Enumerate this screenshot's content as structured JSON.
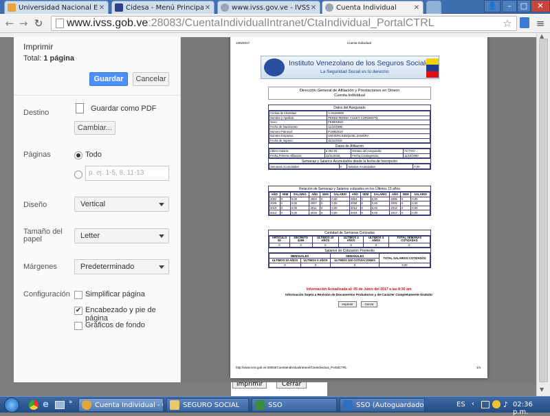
{
  "tabs": [
    {
      "title": "Universidad Nacional Experi",
      "color": "#e8a23a"
    },
    {
      "title": "Cidesa - Menú Principal",
      "color": "#2b3f8c"
    },
    {
      "title": "www.ivss.gov.ve - IVSS Inst",
      "color": "#9aa4b2"
    },
    {
      "title": "Cuenta Individual",
      "color": "#9aa4b2"
    }
  ],
  "window": {
    "minimize": "–",
    "maximize": "□",
    "close": "✕",
    "user": "👤"
  },
  "address": {
    "host": "www.ivss.gob.ve",
    "path": ":28083/CuentaIndividualIntranet/CtaIndividual_PortalCTRL"
  },
  "print": {
    "title": "Imprimir",
    "total_label": "Total:",
    "total_value": "1 página",
    "save_button": "Guardar",
    "cancel_button": "Cancelar",
    "destino_label": "Destino",
    "destino_value": "Guardar como PDF",
    "change_button": "Cambiar...",
    "paginas_label": "Páginas",
    "todo_label": "Todo",
    "range_placeholder": "p. ej. 1-5, 8, 11-13",
    "diseno_label": "Diseño",
    "diseno_value": "Vertical",
    "tamano_label_1": "Tamaño del",
    "tamano_label_2": "papel",
    "tamano_value": "Letter",
    "margenes_label": "Márgenes",
    "margenes_value": "Predeterminado",
    "config_label": "Configuración",
    "opt_simplify": "Simplificar página",
    "opt_header": "Encabezado y pie de página",
    "opt_background": "Gráficos de fondo"
  },
  "doc": {
    "date": "13/6/2017",
    "header_title": "Cuenta Individual",
    "org_name": "Instituto Venezolano de los Seguros Sociales",
    "org_slogan": "La Seguridad Social es tú derecho",
    "direccion": "Dirección General de Afiliación y Prestaciones en Dinero",
    "cuenta": "Cuenta Individual",
    "sec_asegurado": "Datos del Asegurado",
    "asegurado": [
      [
        "Cédula de Identidad:",
        "V-25159006"
      ],
      [
        "Nombre y Apellido:",
        "PEREZ PERNIA YULIET COROMOTO"
      ],
      [
        "Sexo:",
        "FEMENINO"
      ],
      [
        "Fecha de Nacimiento:",
        "11/10/1995"
      ],
      [
        "Número Patronal:",
        "P19852510"
      ],
      [
        "Nombre Empresa:",
        "UNIVERS EZEQUIEL ZAMORA"
      ],
      [
        "Fecha de Ingreso:",
        "11/11/2016"
      ]
    ],
    "sec_afiliacion": "Datos de Afiliación",
    "afiliacion": [
      [
        "Último Salario:",
        "6.352,02",
        "Estatus del Asegurado:",
        "ACTIVO"
      ],
      [
        "Fecha Primera Afiliación:",
        "11/11/2016",
        "Fecha Contingencia:",
        "11/10/2050"
      ]
    ],
    "sec_semanas": "Semanas y Salarios Acumulados desde la fecha de Inscripción",
    "semanas": [
      "Semanas Acumuladas:",
      "0",
      "Salarios Acumulados:",
      "0,00"
    ],
    "sec_relacion": "Relación de Semanas y Salarios cotizados en los Últimos 15 años",
    "relacion_headers": [
      "AÑO",
      "SEM",
      "SALARIO",
      "AÑO",
      "SEM",
      "SALARIO",
      "AÑO",
      "SEM",
      "SALARIO",
      "AÑO",
      "SEM",
      "SALARIO"
    ],
    "relacion_rows": [
      [
        "2002",
        "0",
        "0,00",
        "2003",
        "0",
        "0,00",
        "2004",
        "0",
        "0,00",
        "2005",
        "0",
        "0,00"
      ],
      [
        "2006",
        "0",
        "0,00",
        "2007",
        "0",
        "0,00",
        "2008",
        "0",
        "0,00",
        "2009",
        "0",
        "0,00"
      ],
      [
        "2010",
        "0",
        "0,00",
        "2011",
        "0",
        "0,00",
        "2012",
        "0",
        "0,00",
        "2013",
        "0",
        "0,00"
      ],
      [
        "2014",
        "0",
        "0,00",
        "2015",
        "0",
        "0,00",
        "2016",
        "0",
        "0,00",
        "2017",
        "0",
        "0,00"
      ]
    ],
    "sec_cantidad": "Cantidad de Semanas Cotizadas",
    "cantidad_headers": [
      "ARTICULO 92",
      "DECRETO 4269",
      "ÚLTIMOS 10 AÑOS",
      "ÚLTIMOS 4 AÑOS",
      "ÚLTIMOS 3 AÑOS",
      "TOTAL SEMANAS COTIZADAS"
    ],
    "cantidad_values": [
      "0",
      "0",
      "0",
      "0",
      "0",
      "0"
    ],
    "sec_promedio": "Salarios de Cotización Promedio",
    "mensuales": "MENSUALES",
    "semanales": "SEMANALES",
    "total_salarios": "TOTAL SALARIOS COTIZADOS",
    "promedio_headers": [
      "ÚLTIMOS 10 AÑOS",
      "ÚLTIMOS 5 AÑOS",
      "ÚLTIMOS 100 COTIZACIONES"
    ],
    "promedio_values": [
      "0",
      "0",
      "0",
      "0,00"
    ],
    "info_updated": "Información Actualizada al: 05 de Junio del 2017 a las 8:30 am",
    "info_note": "Información Sujeta a Revisión de Documentos Probatorios y de Carácter Completamente Gratuito",
    "btn_imprimir": "Imprimir",
    "btn_cerrar": "Cerrar",
    "footer_url": "http://www.ivss.gob.ve:28083/CuentaIndividualIntranet/CtaIndividual_PortalCTRL",
    "footer_page": "1/1"
  },
  "behind": {
    "imprimir": "Imprimir",
    "cerrar": "Cerrar"
  },
  "taskbar": {
    "items": [
      {
        "label": "Cuenta Individual - Go...",
        "color": "#e4a736"
      },
      {
        "label": "SEGURO SOCIAL",
        "color": "#e9c86b"
      },
      {
        "label": "SSO",
        "color": "#3d8b40"
      },
      {
        "label": "SSO (Autoguardado)",
        "color": "#2f6fc0"
      }
    ],
    "lang": "ES",
    "clock": "02:36 p.m."
  }
}
